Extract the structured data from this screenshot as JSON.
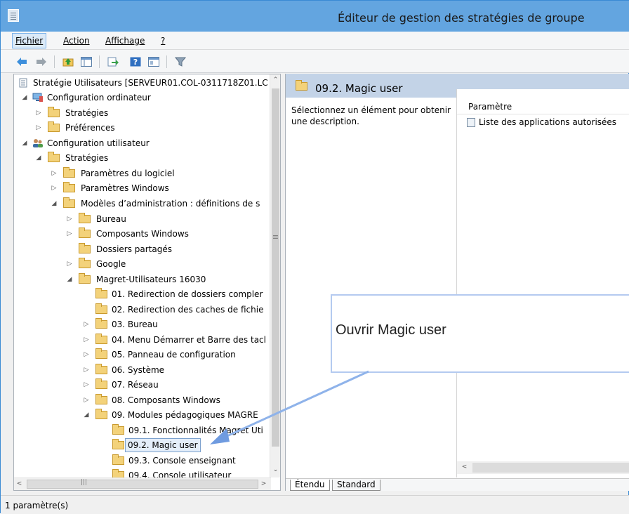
{
  "window": {
    "title": "Éditeur de gestion des stratégies de groupe",
    "app_icon": "gpo-editor-icon",
    "accent_color": "#63a5e0"
  },
  "menubar": {
    "items": [
      {
        "label": "Fichier"
      },
      {
        "label": "Action"
      },
      {
        "label": "Affichage"
      },
      {
        "label": "?"
      }
    ]
  },
  "toolbar": {
    "buttons": [
      "back-arrow-icon",
      "forward-arrow-icon",
      "up-folder-icon",
      "show-hide-tree-icon",
      "export-list-icon",
      "help-icon",
      "properties-view-icon",
      "filter-icon"
    ]
  },
  "tree": {
    "nodes": [
      {
        "label": "Stratégie Utilisateurs [SERVEUR01.COL-0311718Z01.LC"
      },
      {
        "label": "Configuration ordinateur"
      },
      {
        "label": "Stratégies"
      },
      {
        "label": "Préférences"
      },
      {
        "label": "Configuration utilisateur"
      },
      {
        "label": "Stratégies"
      },
      {
        "label": "Paramètres du logiciel"
      },
      {
        "label": "Paramètres Windows"
      },
      {
        "label": "Modèles d’administration : définitions de s"
      },
      {
        "label": "Bureau"
      },
      {
        "label": "Composants Windows"
      },
      {
        "label": "Dossiers partagés"
      },
      {
        "label": "Google"
      },
      {
        "label": "Magret-Utilisateurs 16030"
      },
      {
        "label": "01. Redirection de dossiers compler"
      },
      {
        "label": "02. Redirection des caches de fichie"
      },
      {
        "label": "03. Bureau"
      },
      {
        "label": "04. Menu Démarrer et Barre des tacl"
      },
      {
        "label": "05. Panneau de configuration"
      },
      {
        "label": "06. Système"
      },
      {
        "label": "07. Réseau"
      },
      {
        "label": "08. Composants Windows"
      },
      {
        "label": "09. Modules pédagogiques MAGRE"
      },
      {
        "label": "09.1. Fonctionnalités Magret Uti"
      },
      {
        "label": "09.2. Magic user"
      },
      {
        "label": "09.3. Console enseignant"
      },
      {
        "label": "09.4. Console utilisateur"
      }
    ]
  },
  "right": {
    "header_title": "09.2. Magic user",
    "description": "Sélectionnez un élément pour obtenir une description.",
    "column_header": "Paramètre",
    "rows": [
      "Liste des applications autorisées"
    ]
  },
  "tabs": {
    "extended": "Étendu",
    "standard": "Standard"
  },
  "status": {
    "text": "1 paramètre(s)"
  },
  "callout": {
    "text": "Ouvrir Magic user",
    "border_color": "#b4caf0",
    "arrow_color": "#8fb3ea"
  }
}
